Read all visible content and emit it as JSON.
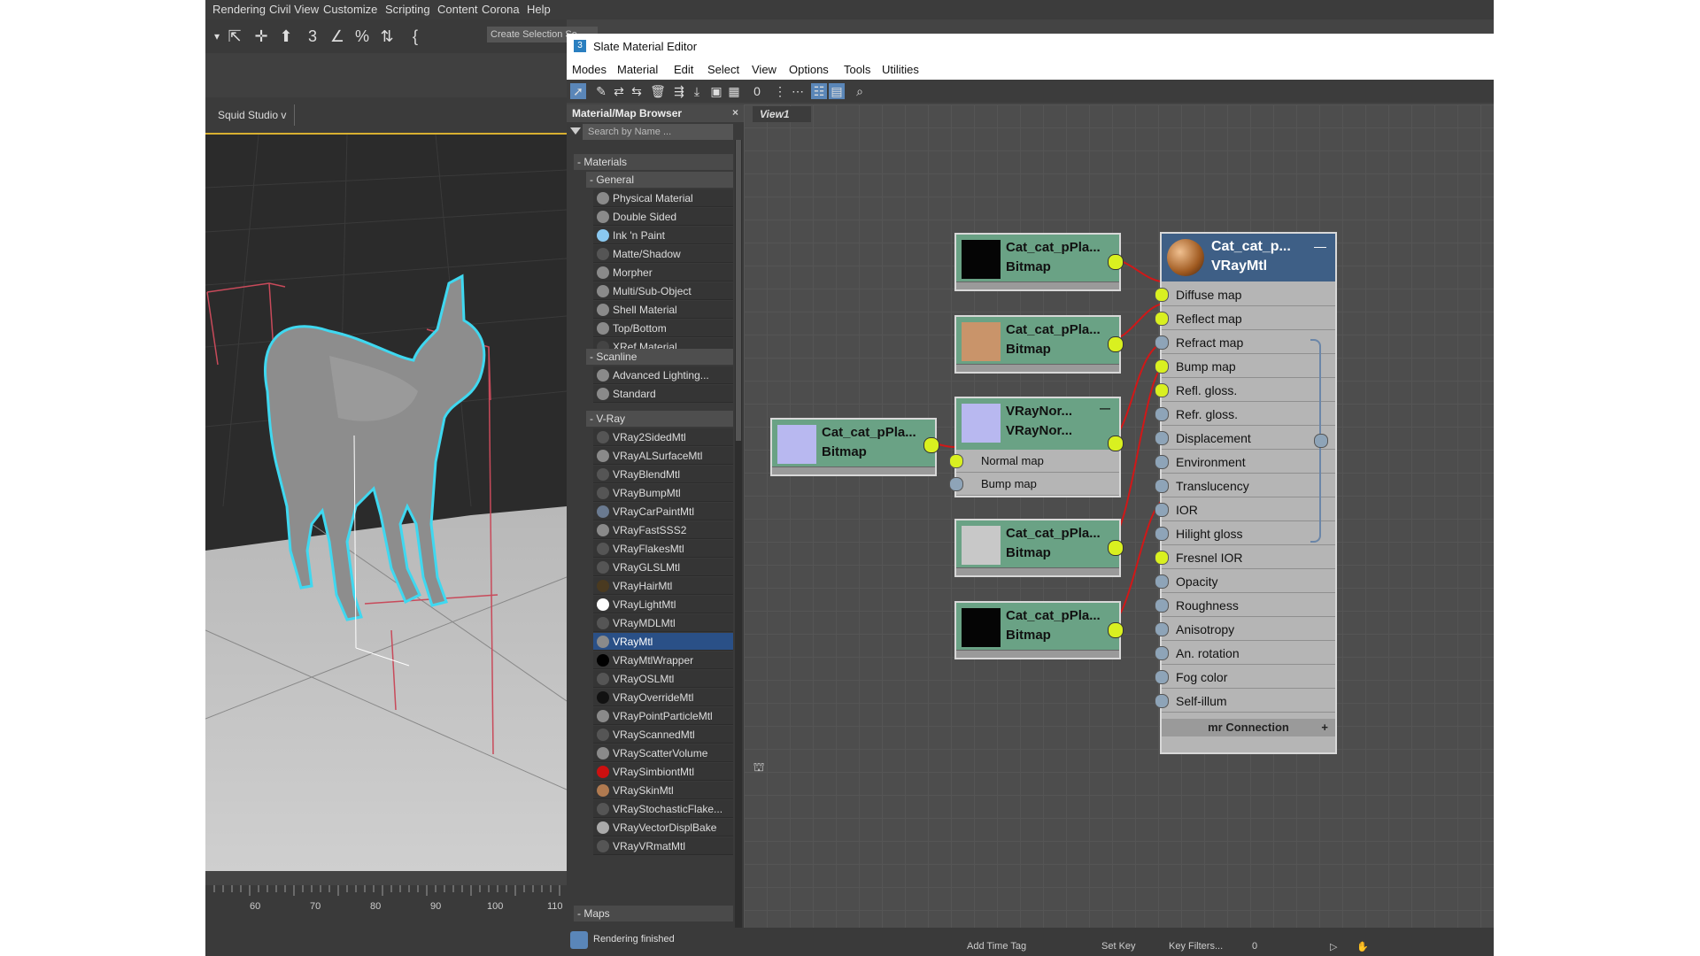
{
  "main_menu": [
    "Rendering",
    "Civil View",
    "Customize",
    "Scripting",
    "Content",
    "Corona",
    "Help"
  ],
  "main_toolbar": {
    "create_selection": "Create Selection Se"
  },
  "viewport": {
    "tab_label": "Squid Studio v"
  },
  "timeline": {
    "ticks": [
      "60",
      "70",
      "80",
      "90",
      "100",
      "110"
    ]
  },
  "slate": {
    "title": "Slate Material Editor",
    "menu": [
      "Modes",
      "Material",
      "Edit",
      "Select",
      "View",
      "Options",
      "Tools",
      "Utilities"
    ],
    "view_tab": "View1",
    "status": "Rendering finished"
  },
  "browser": {
    "title": "Material/Map Browser",
    "close": "×",
    "search_placeholder": "Search by Name ...",
    "materials_label": "- Materials",
    "general_label": "- General",
    "general_items": [
      {
        "label": "Physical Material",
        "swatch": "#8a8a8a"
      },
      {
        "label": "Double Sided",
        "swatch": "#8a8a8a"
      },
      {
        "label": "Ink 'n Paint",
        "swatch": "#8ac8f0"
      },
      {
        "label": "Matte/Shadow",
        "swatch": "#555555"
      },
      {
        "label": "Morpher",
        "swatch": "#8a8a8a"
      },
      {
        "label": "Multi/Sub-Object",
        "swatch": "#8a8a8a"
      },
      {
        "label": "Shell Material",
        "swatch": "#8a8a8a"
      },
      {
        "label": "Top/Bottom",
        "swatch": "#8a8a8a"
      },
      {
        "label": "XRef Material",
        "swatch": "#444444"
      }
    ],
    "scanline_label": "- Scanline",
    "scanline_items": [
      {
        "label": "Advanced Lighting...",
        "swatch": "#8a8a8a"
      },
      {
        "label": "Standard",
        "swatch": "#8a8a8a"
      }
    ],
    "vray_label": "- V-Ray",
    "vray_items": [
      {
        "label": "VRay2SidedMtl",
        "swatch": "#555555"
      },
      {
        "label": "VRayALSurfaceMtl",
        "swatch": "#8a8a8a"
      },
      {
        "label": "VRayBlendMtl",
        "swatch": "#555555"
      },
      {
        "label": "VRayBumpMtl",
        "swatch": "#555555"
      },
      {
        "label": "VRayCarPaintMtl",
        "swatch": "#6a7a90"
      },
      {
        "label": "VRayFastSSS2",
        "swatch": "#8a8a8a"
      },
      {
        "label": "VRayFlakesMtl",
        "swatch": "#555555"
      },
      {
        "label": "VRayGLSLMtl",
        "swatch": "#555555"
      },
      {
        "label": "VRayHairMtl",
        "swatch": "#4a3a20"
      },
      {
        "label": "VRayLightMtl",
        "swatch": "#ffffff"
      },
      {
        "label": "VRayMDLMtl",
        "swatch": "#555555"
      },
      {
        "label": "VRayMtl",
        "swatch": "#8a8a8a",
        "selected": true
      },
      {
        "label": "VRayMtlWrapper",
        "swatch": "#000000"
      },
      {
        "label": "VRayOSLMtl",
        "swatch": "#555555"
      },
      {
        "label": "VRayOverrideMtl",
        "swatch": "#111111"
      },
      {
        "label": "VRayPointParticleMtl",
        "swatch": "#8a8a8a"
      },
      {
        "label": "VRayScannedMtl",
        "swatch": "#555555"
      },
      {
        "label": "VRayScatterVolume",
        "swatch": "#8a8a8a"
      },
      {
        "label": "VRaySimbiontMtl",
        "swatch": "#cc1010"
      },
      {
        "label": "VRaySkinMtl",
        "swatch": "#b07a50"
      },
      {
        "label": "VRayStochasticFlake...",
        "swatch": "#555555"
      },
      {
        "label": "VRayVectorDisplBake",
        "swatch": "#aaaaaa"
      },
      {
        "label": "VRayVRmatMtl",
        "swatch": "#555555"
      }
    ],
    "maps_label": "- Maps"
  },
  "nodes": {
    "bitmap1": {
      "name": "Cat_cat_pPla...",
      "type": "Bitmap",
      "thumb": "#050505"
    },
    "bitmap2": {
      "name": "Cat_cat_pPla...",
      "type": "Bitmap",
      "thumb": "#c9946a"
    },
    "bitmap_left": {
      "name": "Cat_cat_pPla...",
      "type": "Bitmap",
      "thumb": "#b8b8f0"
    },
    "vraynormal": {
      "name": "VRayNor...",
      "type": "VRayNor...",
      "thumb": "#b8b8f0",
      "slots": [
        "Normal map",
        "Bump map"
      ]
    },
    "bitmap3": {
      "name": "Cat_cat_pPla...",
      "type": "Bitmap",
      "thumb": "#c8c8c8"
    },
    "bitmap4": {
      "name": "Cat_cat_pPla...",
      "type": "Bitmap",
      "thumb": "#050505"
    }
  },
  "vraymtl": {
    "name": "Cat_cat_p...",
    "type": "VRayMtl",
    "slots": [
      {
        "label": "Diffuse map",
        "active": true
      },
      {
        "label": "Reflect map",
        "active": true
      },
      {
        "label": "Refract map",
        "active": false
      },
      {
        "label": "Bump map",
        "active": true
      },
      {
        "label": "Refl. gloss.",
        "active": true
      },
      {
        "label": "Refr. gloss.",
        "active": false
      },
      {
        "label": "Displacement",
        "active": false
      },
      {
        "label": "Environment",
        "active": false
      },
      {
        "label": "Translucency",
        "active": false
      },
      {
        "label": "IOR",
        "active": false
      },
      {
        "label": "Hilight gloss",
        "active": false
      },
      {
        "label": "Fresnel IOR",
        "active": true
      },
      {
        "label": "Opacity",
        "active": false
      },
      {
        "label": "Roughness",
        "active": false
      },
      {
        "label": "Anisotropy",
        "active": false
      },
      {
        "label": "An. rotation",
        "active": false
      },
      {
        "label": "Fog color",
        "active": false
      },
      {
        "label": "Self-illum",
        "active": false
      }
    ],
    "connection_label": "mr Connection"
  },
  "bottom_bar": {
    "add_time_tag": "Add Time Tag",
    "set_key": "Set Key",
    "key_filters": "Key Filters...",
    "frame": "0"
  },
  "colors": {
    "wire": "#d01818",
    "active_pin": "#d9f020",
    "selection": "#2a5087",
    "outline": "#3fd8f0"
  }
}
